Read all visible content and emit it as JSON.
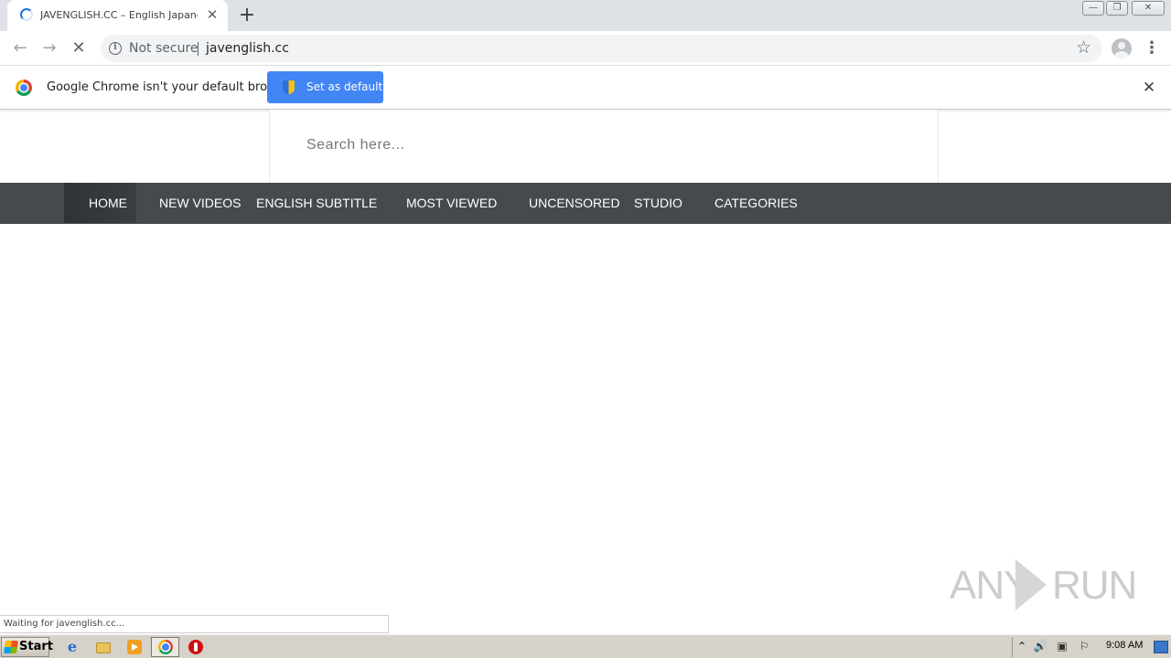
{
  "browser": {
    "tab": {
      "title": "JAVENGLISH.CC – English Japanese",
      "close_glyph": "✕"
    },
    "new_tab_glyph": "+",
    "window_controls": {
      "minimize": "—",
      "restore": "❐",
      "close": "✕"
    },
    "toolbar": {
      "back_glyph": "←",
      "forward_glyph": "→",
      "stop_glyph": "✕",
      "info_glyph": "i",
      "security_label": "Not secure",
      "url": "javenglish.cc",
      "star_glyph": "☆",
      "menu_glyph": "⋮"
    },
    "infobar": {
      "message": "Google Chrome isn't your default browser",
      "button_label": "Set as default",
      "close_glyph": "✕"
    },
    "status_text": "Waiting for javenglish.cc..."
  },
  "page": {
    "search": {
      "placeholder": "Search here..."
    },
    "nav": {
      "items": [
        {
          "label": "HOME"
        },
        {
          "label": "NEW VIDEOS"
        },
        {
          "label": "ENGLISH SUBTITLE"
        },
        {
          "label": "MOST VIEWED"
        },
        {
          "label": "UNCENSORED"
        },
        {
          "label": "STUDIO"
        },
        {
          "label": "CATEGORIES"
        }
      ]
    },
    "colors": {
      "navbar": "#464a4f",
      "accent_button": "#4285f4"
    }
  },
  "watermark": {
    "text_left": "ANY",
    "text_right": "RUN"
  },
  "taskbar": {
    "start_label": "Start",
    "pinned_icons": [
      "ie-icon",
      "folder-icon",
      "media-player-icon",
      "chrome-icon",
      "opera-icon"
    ],
    "tray": {
      "show_hidden_glyph": "⌃",
      "volume_glyph": "🔊",
      "network_glyph": "▣",
      "flag_glyph": "⚐",
      "clock": "9:08 AM"
    }
  }
}
